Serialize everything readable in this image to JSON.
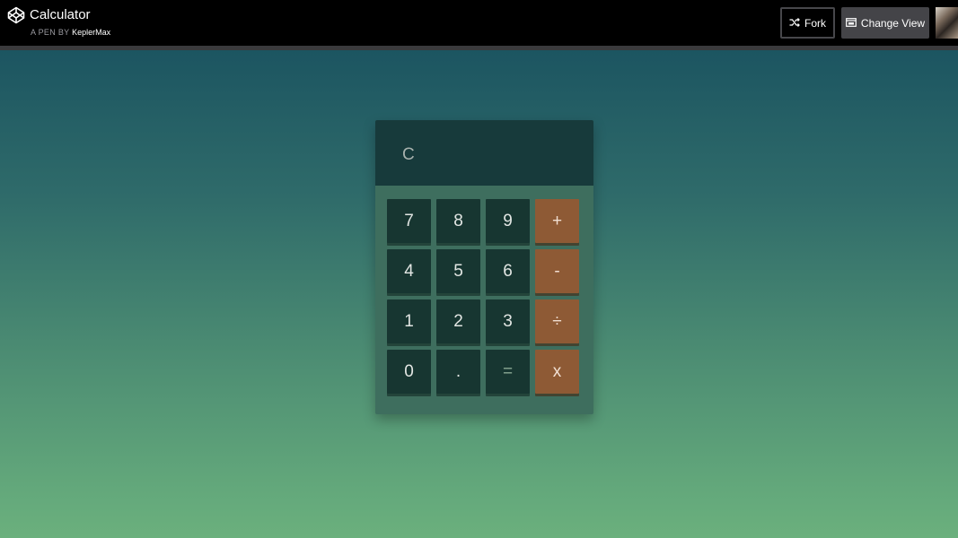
{
  "header": {
    "title": "Calculator",
    "byline_prefix": "A PEN BY",
    "author": "KeplerMax",
    "fork_label": "Fork",
    "change_view_label": "Change View",
    "logo_icon": "codepen-logo-icon",
    "fork_icon": "fork-icon",
    "change_view_icon": "layout-icon"
  },
  "calculator": {
    "display": "C",
    "keys": [
      {
        "label": "7",
        "type": "digit"
      },
      {
        "label": "8",
        "type": "digit"
      },
      {
        "label": "9",
        "type": "digit"
      },
      {
        "label": "+",
        "type": "operator"
      },
      {
        "label": "4",
        "type": "digit"
      },
      {
        "label": "5",
        "type": "digit"
      },
      {
        "label": "6",
        "type": "digit"
      },
      {
        "label": "-",
        "type": "operator"
      },
      {
        "label": "1",
        "type": "digit"
      },
      {
        "label": "2",
        "type": "digit"
      },
      {
        "label": "3",
        "type": "digit"
      },
      {
        "label": "÷",
        "type": "operator"
      },
      {
        "label": "0",
        "type": "digit"
      },
      {
        "label": ".",
        "type": "digit"
      },
      {
        "label": "=",
        "type": "equals"
      },
      {
        "label": "x",
        "type": "operator"
      }
    ]
  },
  "colors": {
    "operator_key": "#8e5a35",
    "digit_key": "#173631",
    "display_background": "#173a3b",
    "background_top": "#1c5561",
    "background_bottom": "#6bb07d"
  }
}
